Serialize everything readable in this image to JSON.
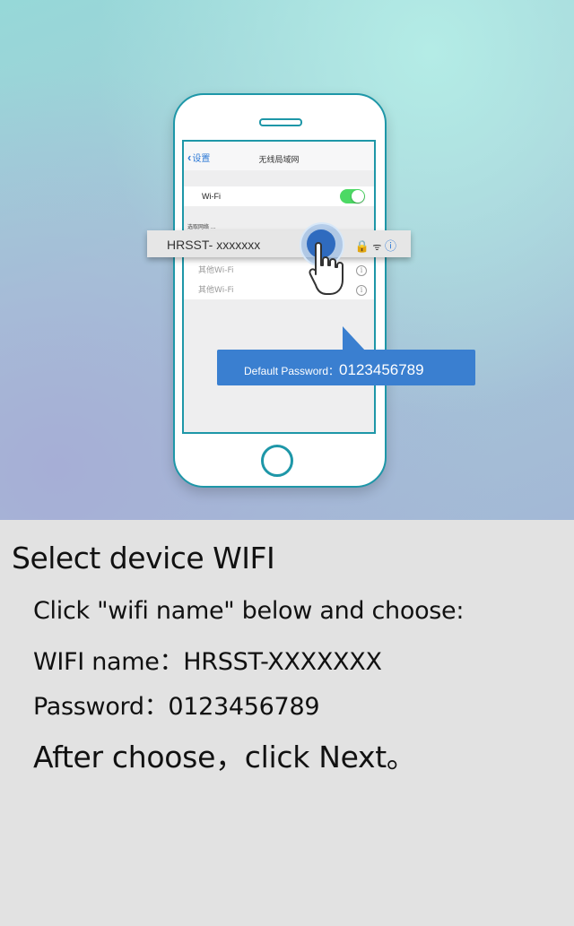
{
  "phone_screen": {
    "back_label": "设置",
    "title": "无线局域网",
    "wifi_label": "Wi-Fi",
    "section_label": "选取网络 ...",
    "other_networks": [
      "其他Wi-Fi",
      "其他Wi-Fi"
    ]
  },
  "selected_network": {
    "name": "HRSST- xxxxxxx"
  },
  "tooltip": {
    "label": "Default Password：",
    "value": "0123456789"
  },
  "instructions": {
    "heading": "Select device WIFI",
    "line1": "Click \"wifi name\" below and choose:",
    "line2": "WIFI name：HRSST-XXXXXXX",
    "line3": "Password：0123456789",
    "line4": "After choose，click Next。"
  },
  "colors": {
    "accent": "#1e97a8",
    "tooltip": "#3a7fd0",
    "toggle_on": "#4cd964"
  }
}
